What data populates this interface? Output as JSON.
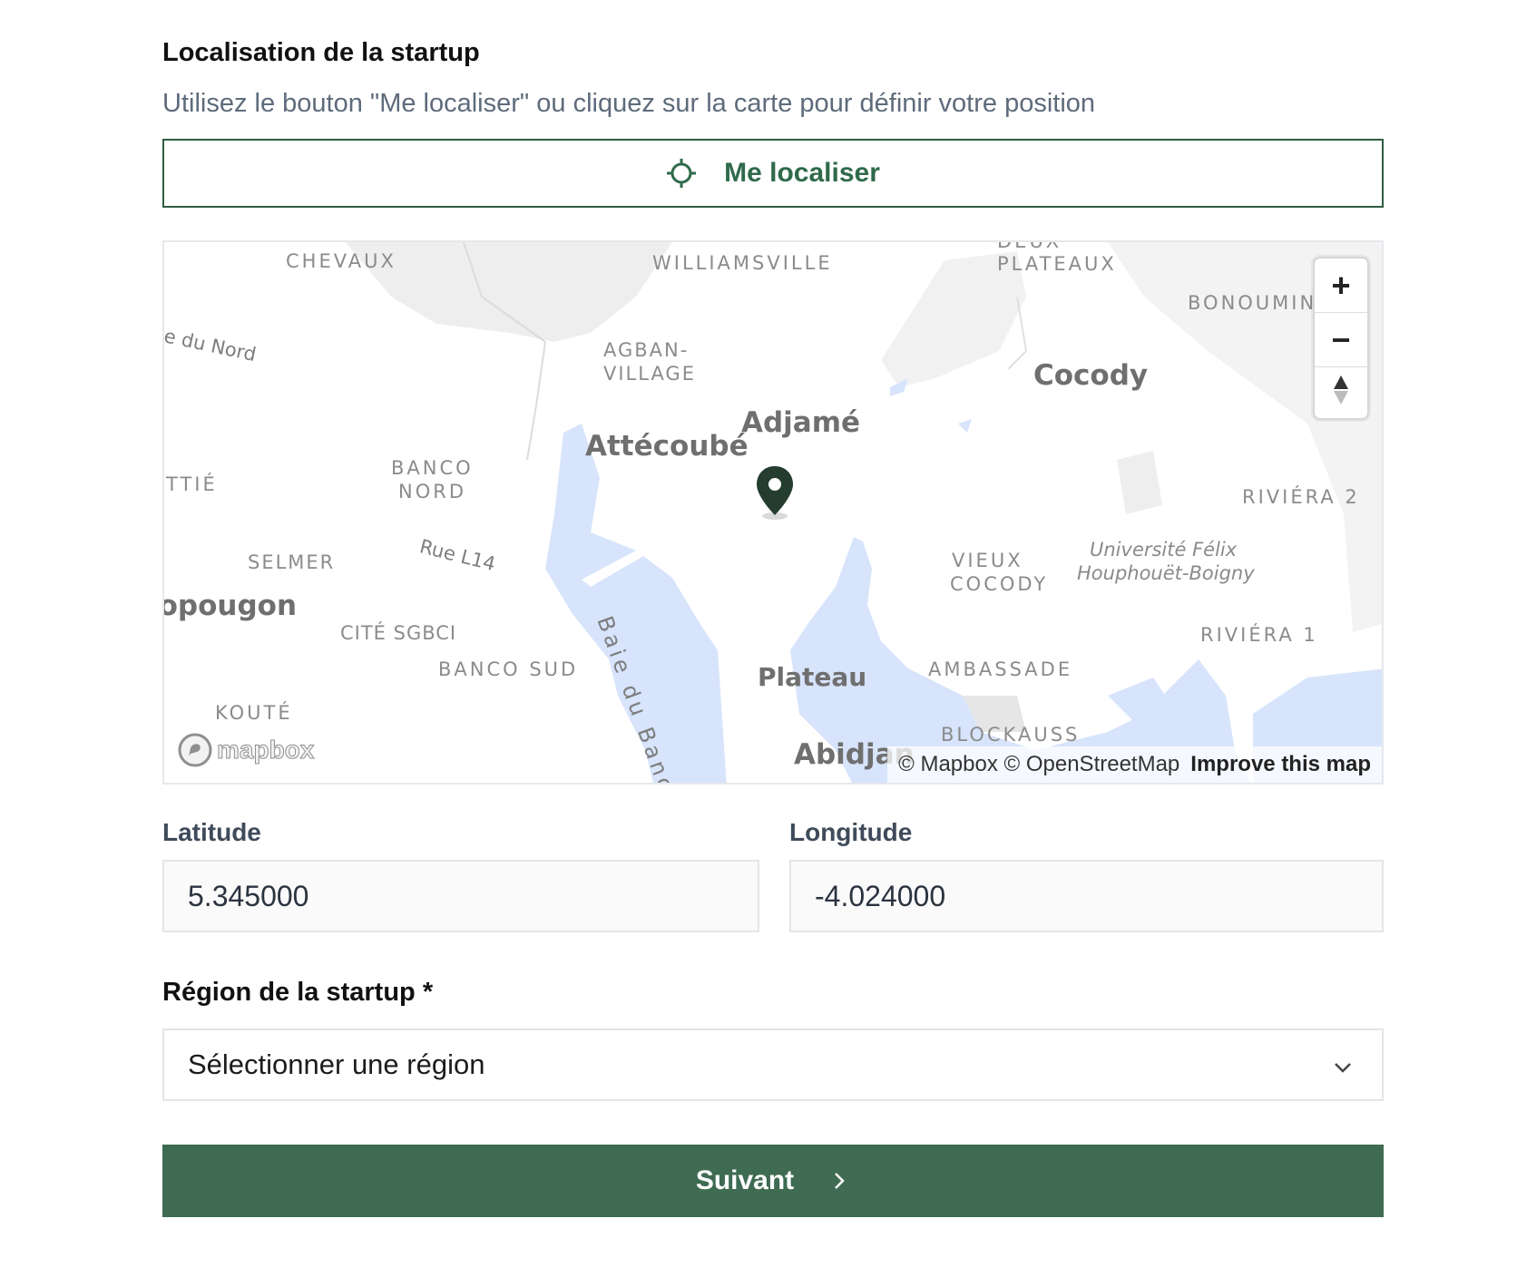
{
  "section": {
    "title": "Localisation de la startup",
    "hint": "Utilisez le bouton \"Me localiser\" ou cliquez sur la carte pour définir votre position"
  },
  "locate_button": {
    "label": "Me localiser",
    "icon": "crosshair-icon"
  },
  "map": {
    "labels": {
      "chevaux": "CHEVAUX",
      "williamsville": "WILLIAMSVILLE",
      "deux_plateaux_top": "DEUX",
      "deux_plateaux": "PLATEAUX",
      "bonoumin": "BONOUMIN",
      "route_du_nord": "e du Nord",
      "agban_village": "AGBAN-",
      "agban_village_2": "VILLAGE",
      "cocody": "Cocody",
      "adjame": "Adjamé",
      "attecoube": "Attécoubé",
      "banco_nord": "BANCO",
      "banco_nord_2": "NORD",
      "attie": "TTIÉ",
      "riviera_2": "RIVIÉRA 2",
      "selmer": "SELMER",
      "rue_l14": "Rue L14",
      "vieux_cocody": "VIEUX",
      "vieux_cocody_2": "COCODY",
      "universite": "Université Félix",
      "universite_2": "Houphouët-Boigny",
      "yopougon": "Yopougon",
      "cite_sgbci": "CITÉ SGBCI",
      "riviera_1": "RIVIÉRA 1",
      "banco_sud": "BANCO SUD",
      "baie_du_banco": "Baie du Banco",
      "plateau": "Plateau",
      "ambassade": "AMBASSADE",
      "koute": "KOUTÉ",
      "blockauss": "BLOCKAUSS",
      "abidjan": "Abidjan"
    },
    "zoom_in": "+",
    "zoom_out": "−",
    "logo_text": "mapbox",
    "attribution": "© Mapbox © OpenStreetMap",
    "improve_link": "Improve this map",
    "colors": {
      "water": "#d7e4fb",
      "land_built": "#eeeeee",
      "marker": "#243d2f"
    }
  },
  "coordinates": {
    "latitude_label": "Latitude",
    "latitude_value": "5.345000",
    "longitude_label": "Longitude",
    "longitude_value": "-4.024000"
  },
  "region": {
    "label": "Région de la startup *",
    "placeholder": "Sélectionner une région"
  },
  "next_button": {
    "label": "Suivant"
  },
  "colors": {
    "accent": "#3e6b52",
    "accent_text": "#2f6a4a",
    "hint": "#5e6b7b"
  }
}
